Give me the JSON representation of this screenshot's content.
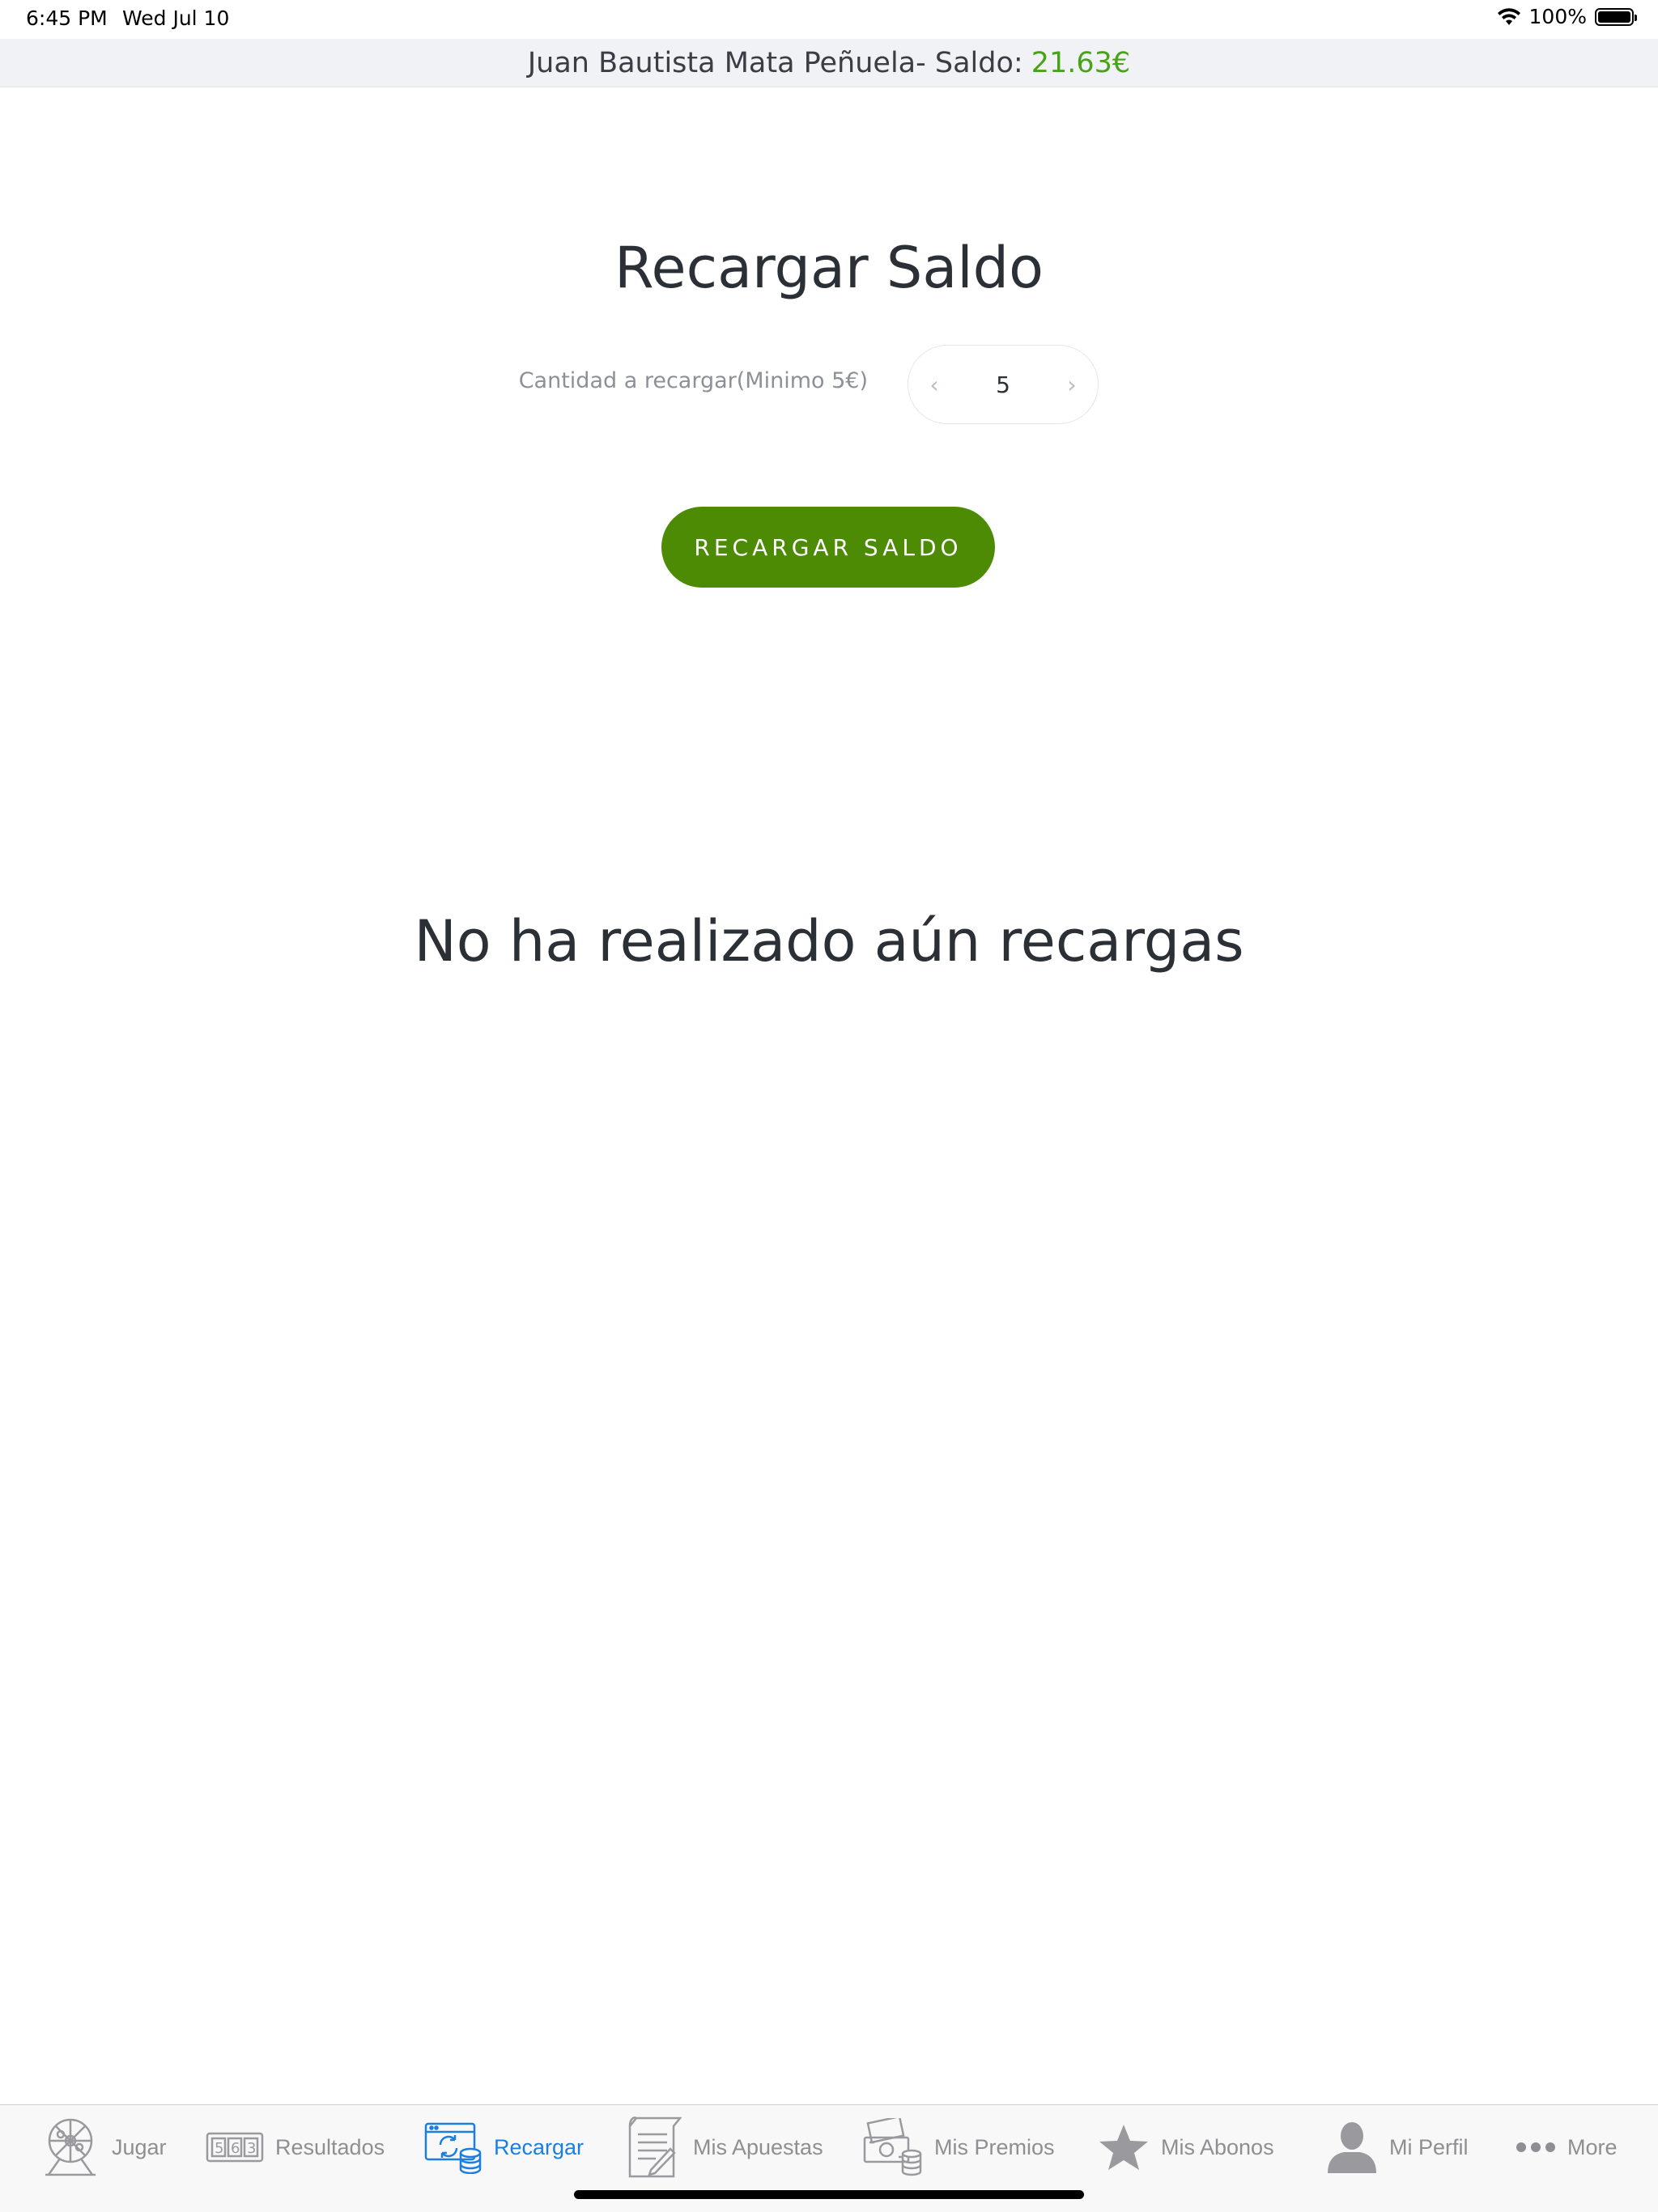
{
  "status_bar": {
    "time": "6:45 PM",
    "date": "Wed Jul 10",
    "battery_percent": "100%",
    "battery_level": 1.0
  },
  "user_bar": {
    "name": "Juan Bautista Mata Peñuela- Saldo:",
    "balance": "21.63€",
    "balance_color": "#47a31a"
  },
  "main": {
    "title": "Recargar Saldo",
    "amount_label": "Cantidad a recargar(Minimo 5€)",
    "amount_value": "5",
    "decrement_symbol": "‹",
    "increment_symbol": "›",
    "recharge_button_label": "RECARGAR SALDO",
    "button_color": "#4e8b05",
    "empty_message": "No ha realizado aún recargas"
  },
  "tab_bar": {
    "active_color": "#1c7fe0",
    "inactive_color": "#8e8e93",
    "tabs": [
      {
        "label": "Jugar",
        "icon": "lottery-drum-icon",
        "active": false
      },
      {
        "label": "Resultados",
        "icon": "results-numbers-icon",
        "active": false
      },
      {
        "label": "Recargar",
        "icon": "recharge-coins-icon",
        "active": true
      },
      {
        "label": "Mis Apuestas",
        "icon": "bets-document-icon",
        "active": false
      },
      {
        "label": "Mis Premios",
        "icon": "prizes-money-icon",
        "active": false
      },
      {
        "label": "Mis Abonos",
        "icon": "star-icon",
        "active": false
      },
      {
        "label": "Mi Perfil",
        "icon": "person-icon",
        "active": false
      },
      {
        "label": "More",
        "icon": "more-dots-icon",
        "active": false
      }
    ]
  }
}
